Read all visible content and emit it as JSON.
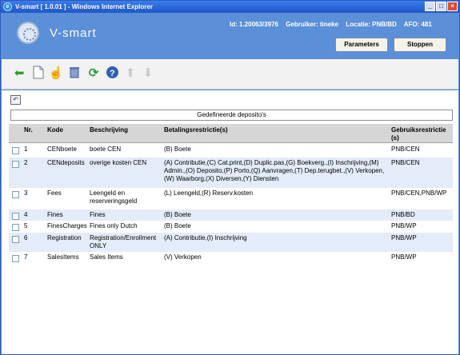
{
  "window": {
    "title": "V-smart [ 1.0.01 ] - Windows Internet Explorer"
  },
  "header": {
    "logo_text": "V-smart",
    "id": "Id: 1.20063/3976",
    "user": "Gebruiker: tineke",
    "location": "Locatie: PNB/BD",
    "afo": "AFO: 481",
    "parameters_label": "Parameters",
    "stop_label": "Stoppen"
  },
  "toolbar": {
    "icons": [
      "back-arrow-icon",
      "new-document-icon",
      "hand-select-icon",
      "trash-icon",
      "refresh-icon",
      "help-icon",
      "up-arrow-icon",
      "down-arrow-icon"
    ]
  },
  "page": {
    "title": "Gedefineerde deposito's"
  },
  "table": {
    "columns": [
      "Nr.",
      "Kode",
      "Beschrijving",
      "Betalingsrestrictie(s)",
      "Gebruiksrestrictie (s)"
    ],
    "rows": [
      {
        "nr": "1",
        "kode": "CENboete",
        "beschrijving": "boete CEN",
        "betaling": "(B) Boete",
        "gebruik": "PNB/CEN"
      },
      {
        "nr": "2",
        "kode": "CENdeposits",
        "beschrijving": "overige kosten CEN",
        "betaling": "(A) Contributie,(C) Cat.print,(D) Duplic.pas,(G) Boekverg.,(I) Inschrijving,(M) Admin.,(O) Deposito,(P) Porto,(Q) Aanvragen,(T) Dep.terugbet.,(V) Verkopen,(W) Waarborg,(X) Diversen,(Y) Diensten",
        "gebruik": "PNB/CEN"
      },
      {
        "nr": "3",
        "kode": "Fees",
        "beschrijving": "Leengeld en reserveringsgeld",
        "betaling": "(L) Leengeld,(R) Reserv.kosten",
        "gebruik": "PNB/CEN,PNB/WP"
      },
      {
        "nr": "4",
        "kode": "Fines",
        "beschrijving": "Fines",
        "betaling": "(B) Boete",
        "gebruik": "PNB/BD"
      },
      {
        "nr": "5",
        "kode": "FinesCharges",
        "beschrijving": "Fines only Dutch",
        "betaling": "(B) Boete",
        "gebruik": "PNB/WP"
      },
      {
        "nr": "6",
        "kode": "Registration",
        "beschrijving": "Registration/Enrollment ONLY",
        "betaling": "(A) Contributie,(I) Inschrijving",
        "gebruik": "PNB/WP"
      },
      {
        "nr": "7",
        "kode": "SalesItems",
        "beschrijving": "Sales Items",
        "betaling": "(V) Verkopen",
        "gebruik": "PNB/WP"
      }
    ]
  }
}
